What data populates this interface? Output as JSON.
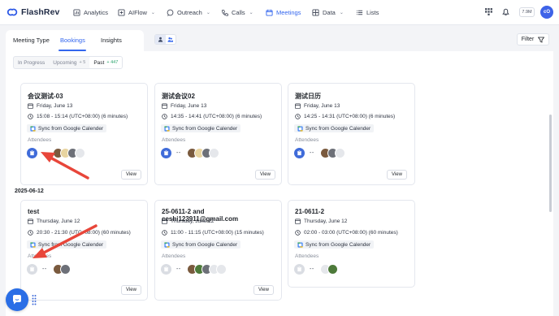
{
  "brand": {
    "name": "FlashRev"
  },
  "nav": [
    {
      "label": "Analytics",
      "icon": "analytics-icon",
      "active": false,
      "dropdown": false
    },
    {
      "label": "AIFlow",
      "icon": "aiflow-icon",
      "active": false,
      "dropdown": true
    },
    {
      "label": "Outreach",
      "icon": "outreach-icon",
      "active": false,
      "dropdown": true
    },
    {
      "label": "Calls",
      "icon": "phone-icon",
      "active": false,
      "dropdown": true
    },
    {
      "label": "Meetings",
      "icon": "meetings-icon",
      "active": true,
      "dropdown": false
    },
    {
      "label": "Data",
      "icon": "data-icon",
      "active": false,
      "dropdown": true
    },
    {
      "label": "Lists",
      "icon": "lists-icon",
      "active": false,
      "dropdown": false
    }
  ],
  "top_right": {
    "storage": "7.9M",
    "avatar_initials": "cO"
  },
  "tabs": [
    "Meeting Type",
    "Bookings",
    "Insights"
  ],
  "active_tab": "Bookings",
  "filter_label": "Filter",
  "subtabs": [
    {
      "label": "In Progress",
      "count": ""
    },
    {
      "label": "Upcoming",
      "count": "+ 5"
    },
    {
      "label": "Past",
      "count": "+ 447"
    }
  ],
  "group_date": "2025-06-12",
  "attendees_label": "Attendees",
  "sync_label": "Sync from Google Calender",
  "view_label": "View",
  "cards_row1": [
    {
      "title": "会议测试-03",
      "date": "Friday, June 13",
      "time": "15:08 - 15:14 (UTC+08:00) (6 minutes)"
    },
    {
      "title": "测试会议02",
      "date": "Friday, June 13",
      "time": "14:35 - 14:41 (UTC+08:00) (6 minutes)"
    },
    {
      "title": "测试日历",
      "date": "Friday, June 13",
      "time": "14:25 - 14:31 (UTC+08:00) (6 minutes)"
    }
  ],
  "cards_row2": [
    {
      "title": "test",
      "date": "Thursday, June 12",
      "time": "20:30 - 21:30 (UTC+08:00) (60 minutes)"
    },
    {
      "title": "25-0611-2 and ceshi123911@gmail.com",
      "date": "Thursday, June 12",
      "time": "11:00 - 11:15 (UTC+08:00) (15 minutes)"
    },
    {
      "title": "21-0611-2",
      "date": "Thursday, June 12",
      "time": "02:00 - 03:00 (UTC+08:00) (60 minutes)"
    }
  ],
  "host_placeholder": "--",
  "colors": {
    "accent": "#3366ee",
    "arrow": "#e8463a",
    "help": "#2a6ee6",
    "green": "#2ea56f"
  }
}
